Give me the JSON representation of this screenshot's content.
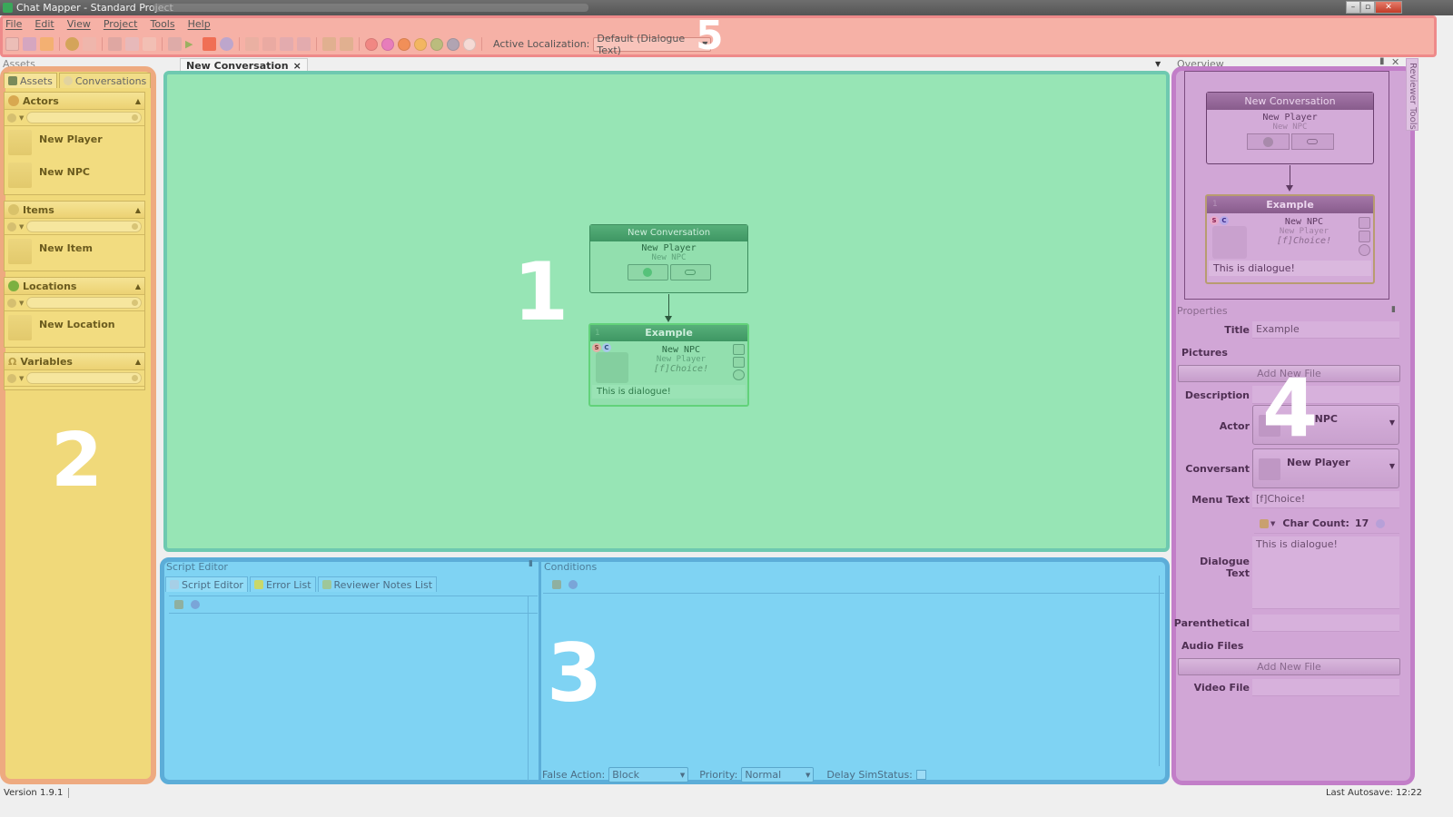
{
  "window": {
    "title": "Chat Mapper - Standard Project",
    "controls": [
      "minimize",
      "restore",
      "close"
    ]
  },
  "menu": [
    "File",
    "Edit",
    "View",
    "Project",
    "Tools",
    "Help"
  ],
  "toolbar": {
    "icons": [
      "new-file-icon",
      "save-icon",
      "open-folder-icon",
      "undo-icon",
      "redo-icon",
      "cut-icon",
      "copy-icon",
      "paste-icon",
      "print-icon",
      "play-icon",
      "html5-icon",
      "globe-icon",
      "zoom-in-icon",
      "zoom-out-icon",
      "zoom-fit-icon",
      "zoom-reset-icon",
      "expand-all-icon",
      "collapse-all-icon"
    ],
    "color_dots": [
      "#f07a78",
      "#e36cc2",
      "#f0843e",
      "#f2b84a",
      "#a8c070",
      "#9aa0b6",
      "#f5e8e5"
    ],
    "localization_label": "Active Localization:",
    "localization_value": "Default (Dialogue Text)"
  },
  "region_labels": {
    "canvas": "1",
    "assets": "2",
    "editors": "3",
    "properties": "4",
    "toolbar": "5"
  },
  "assets_panel": {
    "header": "Assets",
    "tabs": [
      "Assets",
      "Conversations"
    ],
    "groups": [
      {
        "name": "Actors",
        "items": [
          "New Player",
          "New NPC"
        ]
      },
      {
        "name": "Items",
        "items": [
          "New Item"
        ]
      },
      {
        "name": "Locations",
        "items": [
          "New Location"
        ]
      },
      {
        "name": "Variables",
        "items": []
      }
    ]
  },
  "document_tab": {
    "label": "New Conversation",
    "close": "×"
  },
  "canvas": {
    "root_node": {
      "title": "New Conversation",
      "actor": "New Player",
      "conversant": "New NPC"
    },
    "dialogue_node": {
      "id": "1",
      "title": "Example",
      "actor": "New NPC",
      "conversant": "New Player",
      "menu_text": "[f]Choice!",
      "dialogue": "This is dialogue!",
      "badges": [
        "S",
        "C"
      ]
    }
  },
  "script_editor": {
    "title": "Script Editor",
    "tabs": [
      "Script Editor",
      "Error List",
      "Reviewer Notes List"
    ]
  },
  "conditions": {
    "title": "Conditions",
    "false_action_label": "False Action:",
    "false_action_value": "Block",
    "priority_label": "Priority:",
    "priority_value": "Normal",
    "delay_label": "Delay SimStatus:",
    "delay_checked": false
  },
  "overview": {
    "title": "Overview",
    "side_tab": "Reviewer Tools"
  },
  "properties": {
    "title": "Properties",
    "title_label": "Title",
    "title_value": "Example",
    "pictures_label": "Pictures",
    "add_new_file": "Add New File",
    "description_label": "Description",
    "description_value": "",
    "actor_label": "Actor",
    "actor_value": "New NPC",
    "conversant_label": "Conversant",
    "conversant_value": "New Player",
    "menu_text_label": "Menu Text",
    "menu_text_value": "[f]Choice!",
    "char_count_label": "Char Count:",
    "char_count_value": "17",
    "dialogue_text_label": "Dialogue Text",
    "dialogue_text_value": "This is dialogue!",
    "parenthetical_label": "Parenthetical",
    "audio_files_label": "Audio Files",
    "video_file_label": "Video File"
  },
  "status_bar": {
    "version": "Version 1.9.1",
    "autosave": "Last Autosave: 12:22"
  }
}
